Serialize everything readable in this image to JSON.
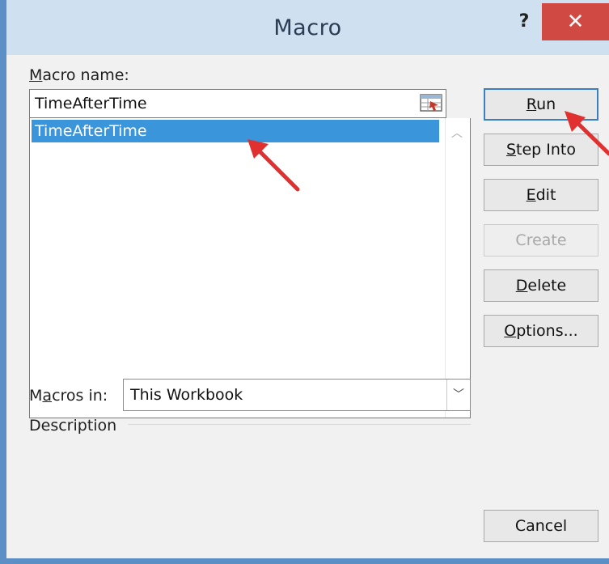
{
  "window": {
    "title": "Macro",
    "help_label": "?",
    "close_label": "✕"
  },
  "macro_name": {
    "label_accel": "M",
    "label_rest": "acro name:",
    "value": "TimeAfterTime"
  },
  "macro_list": {
    "items": [
      "TimeAfterTime"
    ],
    "selected": "TimeAfterTime"
  },
  "buttons": {
    "run": {
      "accel": "R",
      "rest": "un"
    },
    "step_into": {
      "accel": "S",
      "rest": "tep Into"
    },
    "edit": {
      "accel": "E",
      "rest": "dit"
    },
    "create": {
      "label": "Create"
    },
    "delete": {
      "accel": "D",
      "rest": "elete"
    },
    "options": {
      "accel": "O",
      "rest": "ptions..."
    },
    "cancel": {
      "label": "Cancel"
    }
  },
  "macros_in": {
    "label_pre": "M",
    "label_accel": "a",
    "label_rest": "cros in:",
    "value": "This Workbook"
  },
  "description": {
    "label": "Description"
  },
  "colors": {
    "selection": "#3b95db",
    "close": "#d04a43",
    "annotation_arrow": "#e03030"
  }
}
